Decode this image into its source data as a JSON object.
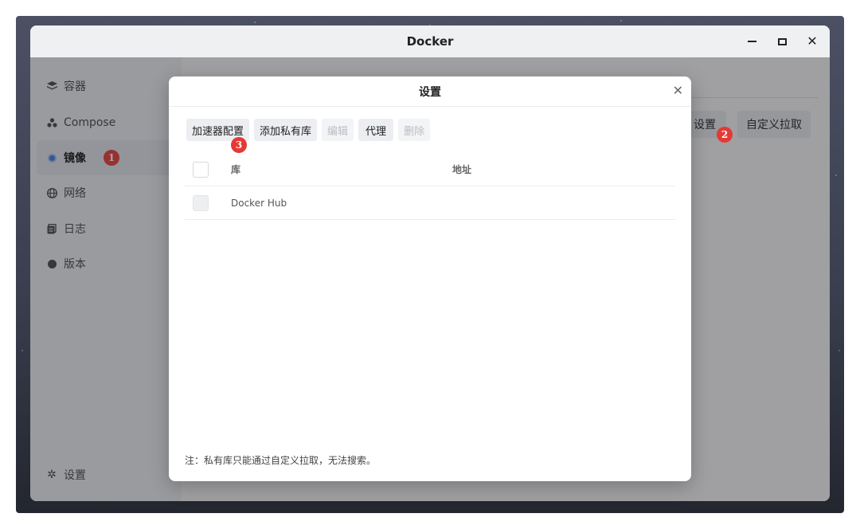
{
  "window": {
    "title": "Docker"
  },
  "sidebar": {
    "items": [
      {
        "label": "容器",
        "icon": "layers-icon",
        "active": false
      },
      {
        "label": "Compose",
        "icon": "compose-icon",
        "active": false
      },
      {
        "label": "镜像",
        "icon": "image-disc-icon",
        "active": true,
        "badge": "1"
      },
      {
        "label": "网络",
        "icon": "globe-icon",
        "active": false
      },
      {
        "label": "日志",
        "icon": "log-icon",
        "active": false
      },
      {
        "label": "版本",
        "icon": "info-icon",
        "active": false
      }
    ],
    "settings": {
      "label": "设置",
      "icon": "gear-icon"
    }
  },
  "main": {
    "buttons": {
      "settings": "设置",
      "settings_badge": "2",
      "custom_pull": "自定义拉取"
    }
  },
  "dialog": {
    "title": "设置",
    "toolbar": {
      "accelerator": "加速器配置",
      "accelerator_badge": "3",
      "add_private": "添加私有库",
      "edit": "编辑",
      "proxy": "代理",
      "delete": "删除"
    },
    "table": {
      "headers": {
        "name": "库",
        "address": "地址"
      },
      "rows": [
        {
          "name": "Docker Hub",
          "address": ""
        }
      ]
    },
    "footnote": "注：私有库只能通过自定义拉取，无法搜索。"
  },
  "colors": {
    "badge": "#e53935",
    "accent": "#3a7bd5"
  }
}
